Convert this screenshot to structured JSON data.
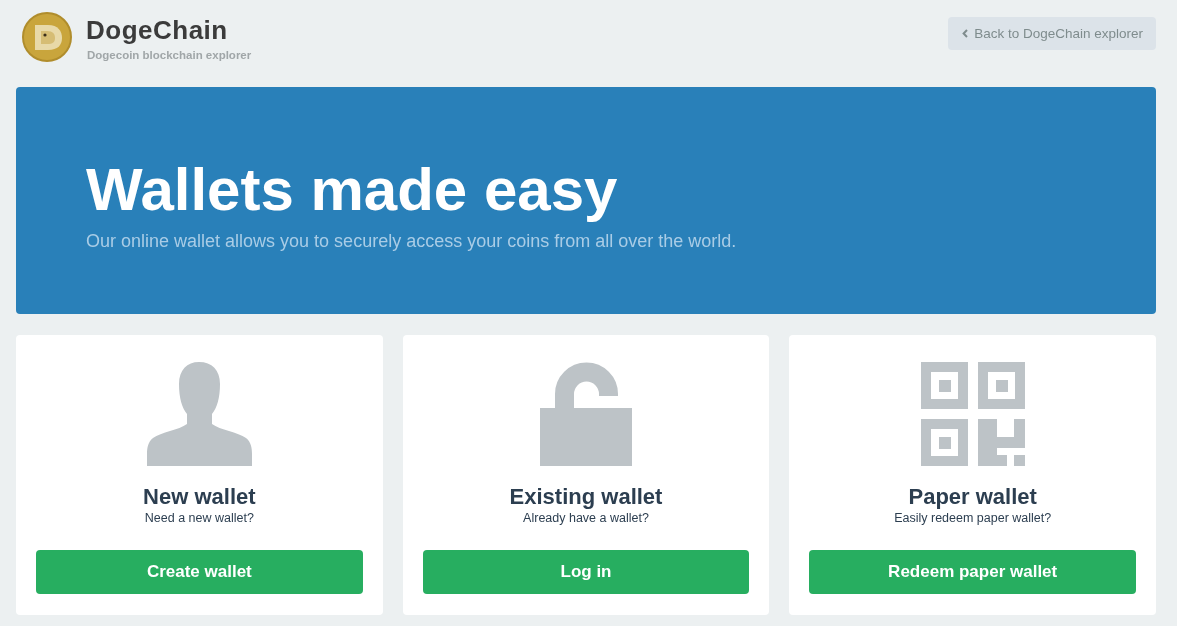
{
  "header": {
    "logo_title": "DogeChain",
    "tagline": "Dogecoin blockchain explorer",
    "back_button": "Back to DogeChain explorer"
  },
  "hero": {
    "title": "Wallets made easy",
    "subtitle": "Our online wallet allows you to securely access your coins from all over the world."
  },
  "cards": [
    {
      "kind": "person",
      "title": "New wallet",
      "subtitle": "Need a new wallet?",
      "button": "Create wallet"
    },
    {
      "kind": "lock",
      "title": "Existing wallet",
      "subtitle": "Already have a wallet?",
      "button": "Log in"
    },
    {
      "kind": "qr",
      "title": "Paper wallet",
      "subtitle": "Easily redeem paper wallet?",
      "button": "Redeem paper wallet"
    }
  ]
}
